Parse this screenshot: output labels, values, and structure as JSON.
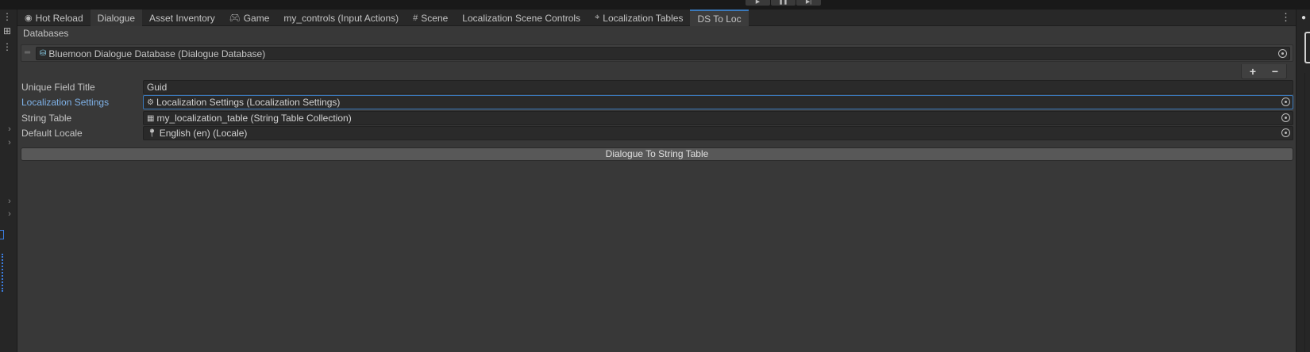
{
  "playbar": {
    "play": "▶",
    "pause": "❚❚",
    "step": "▶|"
  },
  "tabs": [
    {
      "label": "Hot Reload",
      "icon": "flame-icon",
      "glyph": "◉",
      "state": "normal"
    },
    {
      "label": "Dialogue",
      "icon": "",
      "glyph": "",
      "state": "dim"
    },
    {
      "label": "Asset Inventory",
      "icon": "",
      "glyph": "",
      "state": "normal"
    },
    {
      "label": "Game",
      "icon": "gamepad-icon",
      "glyph": "🎮︎",
      "state": "normal"
    },
    {
      "label": "my_controls (Input Actions)",
      "icon": "",
      "glyph": "",
      "state": "normal"
    },
    {
      "label": "Scene",
      "icon": "grid-icon",
      "glyph": "#",
      "state": "normal"
    },
    {
      "label": "Localization Scene Controls",
      "icon": "",
      "glyph": "",
      "state": "normal"
    },
    {
      "label": "Localization Tables",
      "icon": "localization-table-icon",
      "glyph": "⌖",
      "state": "normal"
    },
    {
      "label": "DS To Loc",
      "icon": "",
      "glyph": "",
      "state": "active"
    }
  ],
  "tab_menu_glyph": "⋮",
  "left_toolbar": {
    "menu_glyph": "⋮",
    "add_glyph": "⊞",
    "chevron": "›"
  },
  "databases": {
    "label": "Databases",
    "items": [
      {
        "value": "Bluemoon Dialogue Database (Dialogue Database)",
        "icon": "database-icon",
        "glyph": "⛁"
      }
    ],
    "add_label": "+",
    "remove_label": "−"
  },
  "properties": {
    "unique_field_title": {
      "label": "Unique Field Title",
      "value": "Guid"
    },
    "localization_settings": {
      "label": "Localization Settings",
      "value": "Localization Settings (Localization Settings)",
      "glyph": "⚙"
    },
    "string_table": {
      "label": "String Table",
      "value": "my_localization_table (String Table Collection)",
      "glyph": "▦"
    },
    "default_locale": {
      "label": "Default Locale",
      "value": "English (en) (Locale)",
      "glyph": "📍︎"
    }
  },
  "action_button": {
    "label": "Dialogue To String Table"
  },
  "colors": {
    "accent": "#3a79bb",
    "highlight_label": "#7fb2e8",
    "panel_bg": "#383838"
  }
}
